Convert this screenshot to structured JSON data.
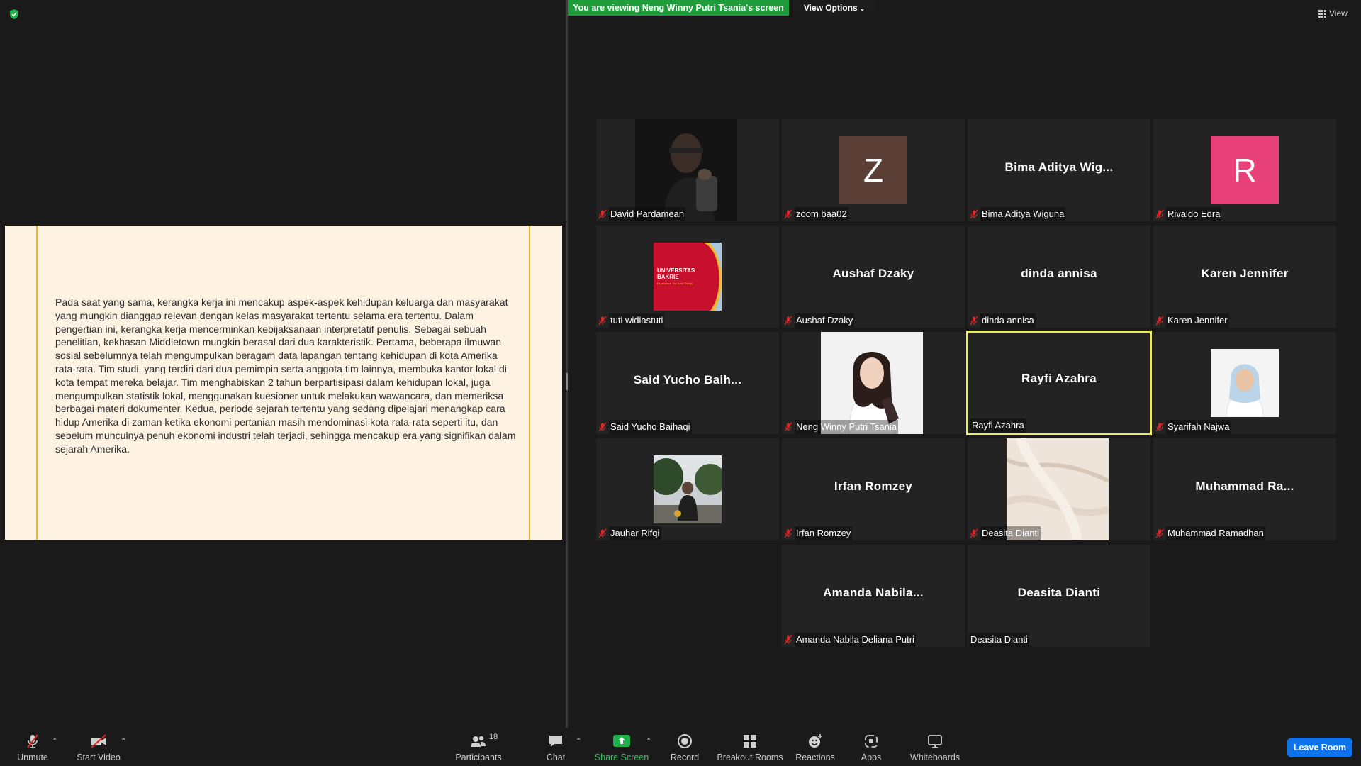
{
  "meeting": {
    "banner": "You are viewing Neng Winny Putri Tsania's screen",
    "view_options": "View Options",
    "view_button": "View"
  },
  "shared_slide": {
    "text": "Pada saat yang sama, kerangka kerja ini mencakup aspek-aspek kehidupan keluarga dan masyarakat yang mungkin dianggap relevan dengan kelas masyarakat tertentu selama era tertentu. Dalam pengertian ini, kerangka kerja mencerminkan kebijaksanaan interpretatif penulis. Sebagai sebuah penelitian, kekhasan Middletown mungkin berasal dari dua karakteristik. Pertama, beberapa ilmuwan sosial sebelumnya telah mengumpulkan beragam data lapangan tentang kehidupan di kota Amerika rata-rata. Tim studi, yang terdiri dari dua pemimpin serta anggota tim lainnya, membuka kantor lokal di kota tempat mereka belajar. Tim menghabiskan 2 tahun berpartisipasi dalam kehidupan lokal, juga mengumpulkan statistik lokal, menggunakan kuesioner untuk melakukan wawancara, dan memeriksa berbagai materi dokumenter. Kedua, periode sejarah tertentu yang sedang dipelajari menangkap cara hidup Amerika di zaman ketika ekonomi pertanian masih mendominasi kota rata-rata seperti itu, dan sebelum munculnya penuh ekonomi industri telah terjadi, sehingga mencakup era yang signifikan dalam sejarah Amerika."
  },
  "participants": [
    {
      "label": "David Pardamean",
      "big": "",
      "muted": true,
      "kind": "photo-man"
    },
    {
      "label": "zoom baa02",
      "big": "",
      "avatar": "Z",
      "avatar_color": "#5b3f36",
      "muted": true,
      "kind": "avatar"
    },
    {
      "label": "Bima Aditya Wiguna",
      "big": "Bima  Aditya  Wig...",
      "muted": true,
      "kind": "name"
    },
    {
      "label": "Rivaldo Edra",
      "big": "",
      "avatar": "R",
      "avatar_color": "#e8417a",
      "muted": true,
      "kind": "avatar"
    },
    {
      "label": "tuti widiastuti",
      "big": "",
      "muted": true,
      "kind": "photo-ub",
      "logo_text": "UNIVERSITAS BAKRIE",
      "logo_sub": "Experience The Best Things"
    },
    {
      "label": "Aushaf Dzaky",
      "big": "Aushaf  Dzaky",
      "muted": true,
      "kind": "name"
    },
    {
      "label": "dinda annisa",
      "big": "dinda  annisa",
      "muted": true,
      "kind": "name"
    },
    {
      "label": "Karen Jennifer",
      "big": "Karen  Jennifer",
      "muted": true,
      "kind": "name"
    },
    {
      "label": "Said Yucho Baihaqi",
      "big": "Said  Yucho  Baih...",
      "muted": true,
      "kind": "name"
    },
    {
      "label": "Neng Winny Putri Tsania",
      "big": "",
      "muted": true,
      "kind": "photo-hijab"
    },
    {
      "label": "Rayfi Azahra",
      "big": "Rayfi  Azahra",
      "muted": false,
      "kind": "name",
      "active": true
    },
    {
      "label": "Syarifah Najwa",
      "big": "",
      "muted": true,
      "kind": "photo-najwa"
    },
    {
      "label": "Jauhar Rifqi",
      "big": "",
      "muted": true,
      "kind": "photo-outdoor"
    },
    {
      "label": "Irfan Romzey",
      "big": "Irfan  Romzey",
      "muted": true,
      "kind": "name"
    },
    {
      "label": "Deasita Dianti",
      "big": "",
      "muted": true,
      "kind": "photo-marble"
    },
    {
      "label": "Muhammad Ramadhan",
      "big": "Muhammad   Ra...",
      "muted": true,
      "kind": "name"
    },
    {
      "label": "Amanda Nabila Deliana Putri",
      "big": "Amanda  Nabila...",
      "muted": true,
      "kind": "name"
    },
    {
      "label": "Deasita Dianti",
      "big": "Deasita  Dianti",
      "muted": false,
      "kind": "name"
    }
  ],
  "toolbar": {
    "unmute": "Unmute",
    "start_video": "Start Video",
    "participants": "Participants",
    "participants_count": "18",
    "chat": "Chat",
    "share_screen": "Share Screen",
    "record": "Record",
    "breakout_rooms": "Breakout Rooms",
    "reactions": "Reactions",
    "apps": "Apps",
    "whiteboards": "Whiteboards",
    "leave": "Leave Room"
  },
  "colors": {
    "share_green": "#1f9d3a",
    "active_border": "#e8e86a",
    "leave_blue": "#0e72ed",
    "mute_red": "#e02828"
  }
}
